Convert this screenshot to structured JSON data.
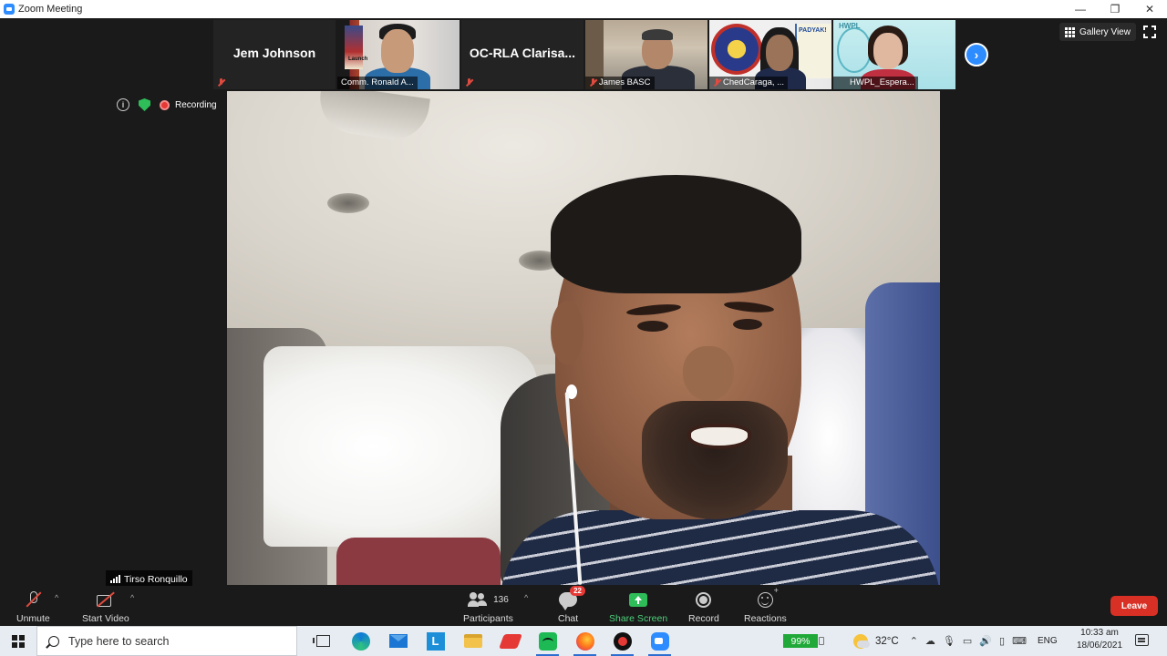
{
  "window": {
    "title": "Zoom Meeting",
    "controls": {
      "minimize": "—",
      "restore": "❐",
      "close": "✕"
    }
  },
  "participants_strip": [
    {
      "name": "Jem Johnson",
      "type": "name-only",
      "muted": true
    },
    {
      "name": "Comm. Ronald A...",
      "type": "video",
      "muted": false
    },
    {
      "name": "OC-RLA  Clarisa...",
      "type": "name-only",
      "muted": true
    },
    {
      "name": "James BASC",
      "type": "video",
      "muted": true
    },
    {
      "name": "ChedCaraga, ...",
      "type": "video",
      "muted": true
    },
    {
      "name": "HWPL_Espera...",
      "type": "video",
      "muted": false
    }
  ],
  "thumb_text": {
    "launch": "Launch",
    "padyak": "PADYAK!",
    "hwpl": "HWPL"
  },
  "view": {
    "gallery_label": "Gallery View",
    "next_icon": "›"
  },
  "status": {
    "info_icon": "i",
    "recording_label": "Recording"
  },
  "main_speaker": {
    "name": "Tirso Ronquillo"
  },
  "toolbar": {
    "unmute": "Unmute",
    "start_video": "Start Video",
    "participants_label": "Participants",
    "participants_count": "136",
    "chat_label": "Chat",
    "chat_badge": "22",
    "share_label": "Share Screen",
    "record_label": "Record",
    "reactions_label": "Reactions",
    "leave_label": "Leave",
    "caret": "^"
  },
  "taskbar": {
    "search_placeholder": "Type here to search",
    "battery": "99%",
    "temperature": "32°C",
    "language": "ENG",
    "time": "10:33 am",
    "date": "18/06/2021",
    "l_app": "L"
  },
  "colors": {
    "accent": "#2d8cff",
    "leave": "#d93025",
    "recording": "#e53935",
    "share": "#2ebd59"
  }
}
